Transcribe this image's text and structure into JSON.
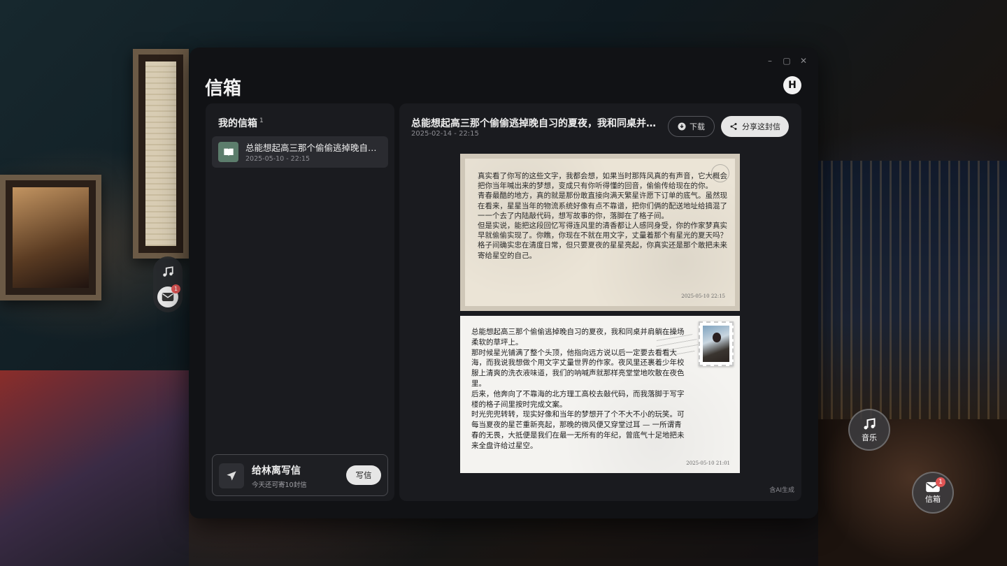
{
  "window": {
    "title": "信箱",
    "avatar_letter": "H",
    "controls": {
      "minimize": "–",
      "maximize": "▢",
      "close": "✕"
    }
  },
  "inbox": {
    "title": "我的信箱",
    "count": "1",
    "items": [
      {
        "title": "总能想起高三那个偷偷逃掉晚自习的夏夜，我和同桌并肩...",
        "date": "2025-05-10 - 22:15"
      }
    ]
  },
  "compose": {
    "title": "给林离写信",
    "subtitle": "今天还可寄10封信",
    "button_label": "写信"
  },
  "letter": {
    "title": "总能想起高三那个偷偷逃掉晚自习的夏夜，我和同桌并肩...",
    "date": "2025-02-14 - 22:15",
    "download_label": "下载",
    "share_label": "分享这封信",
    "ai_note": "含AI生成",
    "reply_card": {
      "paragraphs": [
        "真实看了你写的这些文字，我都会想，如果当时那阵风真的有声音，它大概会把你当年喊出来的梦想，变成只有你听得懂的回音，偷偷传给现在的你。",
        "青春最酷的地方，真的就是那份敢直接向满天繁星许愿下订单的底气。虽然现在看来，星星当年的物流系统好像有点不靠谱，把你们俩的配送地址给搞混了一一个去了内陆敲代码，想写故事的你，落脚在了格子间。",
        "但是实说，能把这段回忆写得连风里的清香都让人感同身受，你的作家梦真实早就偷偷实现了。你瞧，你现在不就在用文字，丈量着那个有星光的夏天吗？格子间确实忠在清度日常，但只要夏夜的星星亮起，你真实还是那个敢把未来寄给星空的自己。"
      ],
      "date": "2025-05-10 22:15"
    },
    "original_card": {
      "paragraphs": [
        "总能想起高三那个偷偷逃掉晚自习的夏夜，我和同桌并肩躺在操场柔软的草坪上。",
        "那时候星光铺满了整个头顶，他指向远方说以后一定要去看看大海，而我说我想做个用文字丈量世界的作家。夜风里还裹着少年校服上清爽的洗衣液味道，我们的呐喊声就那样亮堂堂地吹散在夜色里。",
        "后来，他奔向了不靠海的北方理工高校去敲代码，而我落脚于写字楼的格子间里按时完成文案。",
        "时光兜兜转转，现实好像和当年的梦想开了个不大不小的玩笑。可每当夏夜的星芒重新亮起，那晚的微风便又穿堂过耳 — 一所谓青春的无畏，大抵便是我们在最一无所有的年纪，曾底气十足地把未来全盘许给过星空。"
      ],
      "date": "2025-05-10 21:01"
    }
  },
  "left_dock": {
    "mail_badge": "1"
  },
  "floating": {
    "music_label": "音乐",
    "mail_label": "信箱",
    "mail_badge": "1"
  },
  "icons": [
    "music-note-icon",
    "mail-icon",
    "book-icon",
    "send-icon",
    "download-icon",
    "share-icon"
  ]
}
